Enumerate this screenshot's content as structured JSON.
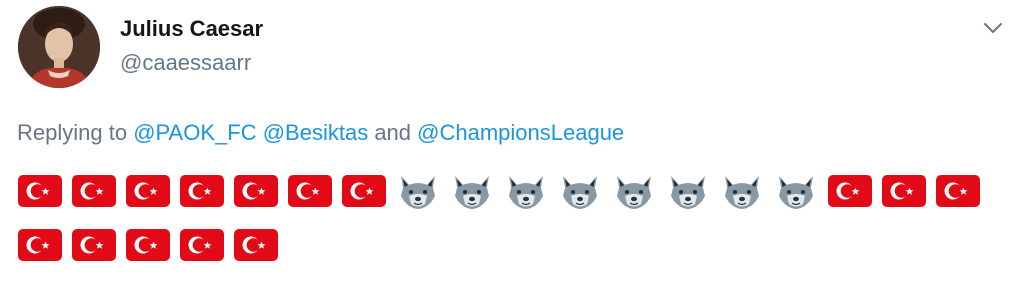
{
  "user": {
    "display_name": "Julius Caesar",
    "handle": "@caaessaarr",
    "avatar_icon": "portrait-avatar"
  },
  "header": {
    "menu_icon": "chevron-down-icon"
  },
  "reply": {
    "prefix": "Replying to ",
    "mentions": [
      "@PAOK_FC",
      "@Besiktas",
      "@ChampionsLeague"
    ],
    "separator": " ",
    "conjunction": " and "
  },
  "body": {
    "rows": [
      [
        "flag-turkey",
        "flag-turkey",
        "flag-turkey",
        "flag-turkey",
        "flag-turkey",
        "flag-turkey",
        "flag-turkey",
        "wolf-face",
        "wolf-face",
        "wolf-face",
        "wolf-face",
        "wolf-face",
        "wolf-face",
        "wolf-face",
        "wolf-face",
        "flag-turkey",
        "flag-turkey",
        "flag-turkey"
      ],
      [
        "flag-turkey",
        "flag-turkey",
        "flag-turkey",
        "flag-turkey",
        "flag-turkey"
      ]
    ]
  },
  "colors": {
    "name": "#14171a",
    "muted": "#657786",
    "link": "#1b95e0",
    "flag_red": "#e30a17",
    "wolf_gray": "#8899a6"
  }
}
